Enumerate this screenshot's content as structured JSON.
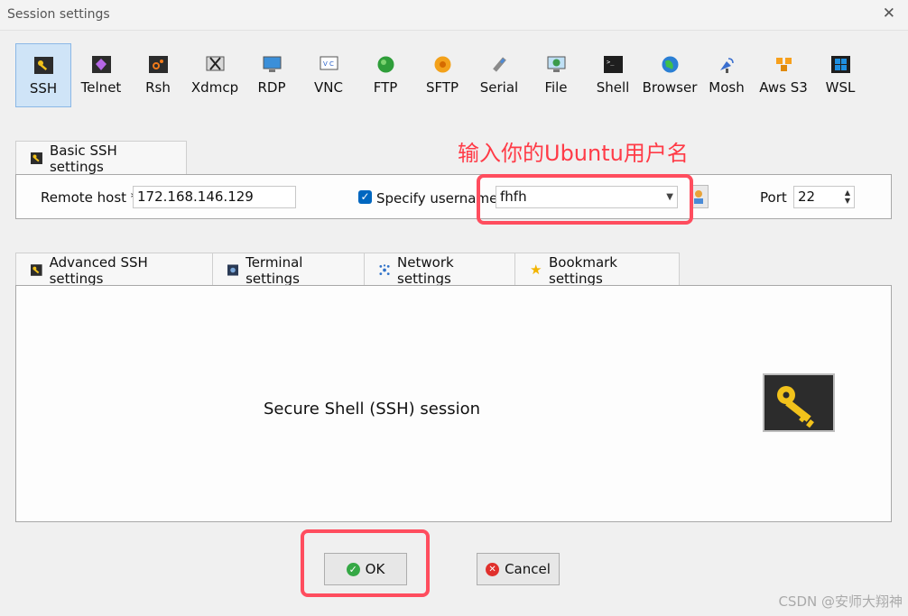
{
  "window": {
    "title": "Session settings",
    "close_glyph": "✕"
  },
  "session_types": [
    {
      "label": "SSH",
      "icon": "ssh-key-icon",
      "active": true
    },
    {
      "label": "Telnet",
      "icon": "telnet-icon"
    },
    {
      "label": "Rsh",
      "icon": "rsh-icon"
    },
    {
      "label": "Xdmcp",
      "icon": "xdmcp-icon"
    },
    {
      "label": "RDP",
      "icon": "rdp-icon"
    },
    {
      "label": "VNC",
      "icon": "vnc-icon"
    },
    {
      "label": "FTP",
      "icon": "ftp-icon"
    },
    {
      "label": "SFTP",
      "icon": "sftp-icon"
    },
    {
      "label": "Serial",
      "icon": "serial-icon"
    },
    {
      "label": "File",
      "icon": "file-icon"
    },
    {
      "label": "Shell",
      "icon": "shell-icon"
    },
    {
      "label": "Browser",
      "icon": "browser-icon"
    },
    {
      "label": "Mosh",
      "icon": "mosh-icon"
    },
    {
      "label": "Aws S3",
      "icon": "aws-s3-icon"
    },
    {
      "label": "WSL",
      "icon": "wsl-icon"
    }
  ],
  "basic_tab": {
    "label": "Basic SSH settings"
  },
  "basic": {
    "remote_host_label": "Remote host *",
    "remote_host_value": "172.168.146.129",
    "specify_username_label": "Specify username",
    "specify_username_checked": true,
    "username_value": "fhfh",
    "port_label": "Port",
    "port_value": "22"
  },
  "annotation": {
    "text": "输入你的Ubuntu用户名",
    "color": "#ff3b47"
  },
  "advanced_tabs": [
    {
      "label": "Advanced SSH settings",
      "icon": "key-icon"
    },
    {
      "label": "Terminal settings",
      "icon": "terminal-icon"
    },
    {
      "label": "Network settings",
      "icon": "network-icon"
    },
    {
      "label": "Bookmark settings",
      "icon": "star-icon"
    }
  ],
  "session_description": "Secure Shell (SSH) session",
  "buttons": {
    "ok": "OK",
    "cancel": "Cancel"
  },
  "watermark": "CSDN @安师大翔神",
  "colors": {
    "accent": "#0067c0",
    "active_tab_bg": "#cfe4f7",
    "annotation_red": "#ff4d5e"
  }
}
